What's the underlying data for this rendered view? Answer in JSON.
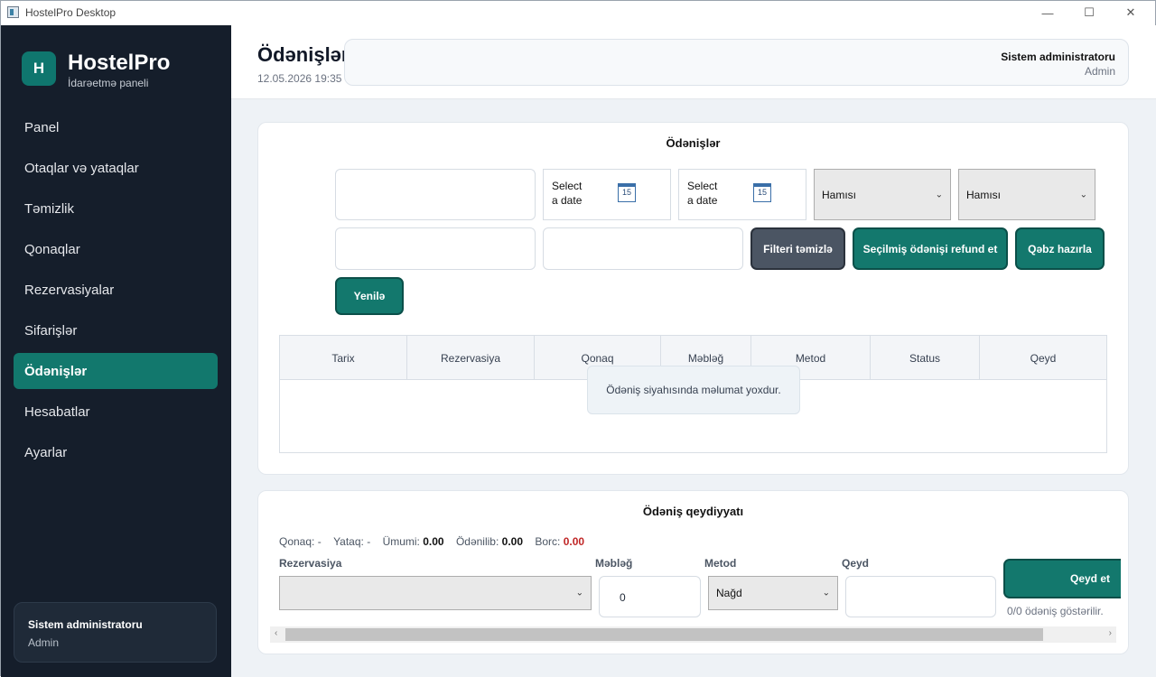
{
  "window": {
    "title": "HostelPro Desktop"
  },
  "sidebar": {
    "logo_letter": "H",
    "brand": "HostelPro",
    "subtitle": "İdarəetmə paneli",
    "items": [
      {
        "label": "Panel"
      },
      {
        "label": "Otaqlar və yataqlar"
      },
      {
        "label": "Təmizlik"
      },
      {
        "label": "Qonaqlar"
      },
      {
        "label": "Rezervasiyalar"
      },
      {
        "label": "Sifarişlər"
      },
      {
        "label": "Ödənişlər",
        "active": true
      },
      {
        "label": "Hesabatlar"
      },
      {
        "label": "Ayarlar"
      }
    ],
    "user": {
      "name": "Sistem administratoru",
      "role": "Admin"
    }
  },
  "header": {
    "title": "Ödənişlər",
    "datetime": "12.05.2026 19:35",
    "user_name": "Sistem administratoru",
    "user_role": "Admin"
  },
  "filters": {
    "panel_title": "Ödənişlər",
    "date_from_placeholder_1": "Select",
    "date_from_placeholder_2": "a date",
    "date_to_placeholder_1": "Select",
    "date_to_placeholder_2": "a date",
    "calendar_day": "15",
    "method_select": "Hamısı",
    "status_select": "Hamısı",
    "clear_button": "Filteri təmizlə",
    "refund_button": "Seçilmiş ödənişi refund et",
    "receipt_button": "Qəbz hazırla",
    "refresh_button": "Yenilə"
  },
  "table": {
    "columns": [
      "Tarix",
      "Rezervasiya",
      "Qonaq",
      "Məbləğ",
      "Metod",
      "Status",
      "Qeyd"
    ],
    "empty_message": "Ödəniş siyahısında məlumat yoxdur."
  },
  "registration": {
    "title": "Ödəniş qeydiyyatı",
    "guest_label": "Qonaq:",
    "guest_value": "-",
    "bed_label": "Yataq:",
    "bed_value": "-",
    "total_label": "Ümumi:",
    "total_value": "0.00",
    "paid_label": "Ödənilib:",
    "paid_value": "0.00",
    "debt_label": "Borc:",
    "debt_value": "0.00",
    "reservation_label": "Rezervasiya",
    "amount_label": "Məbləğ",
    "amount_value": "0",
    "method_label": "Metod",
    "method_value": "Nağd",
    "note_label": "Qeyd",
    "save_button": "Qeyd et",
    "count_text": "0/0 ödəniş göstərilir."
  },
  "colors": {
    "accent": "#13786d",
    "sidebar": "#151e2b",
    "debt": "#c02626"
  }
}
